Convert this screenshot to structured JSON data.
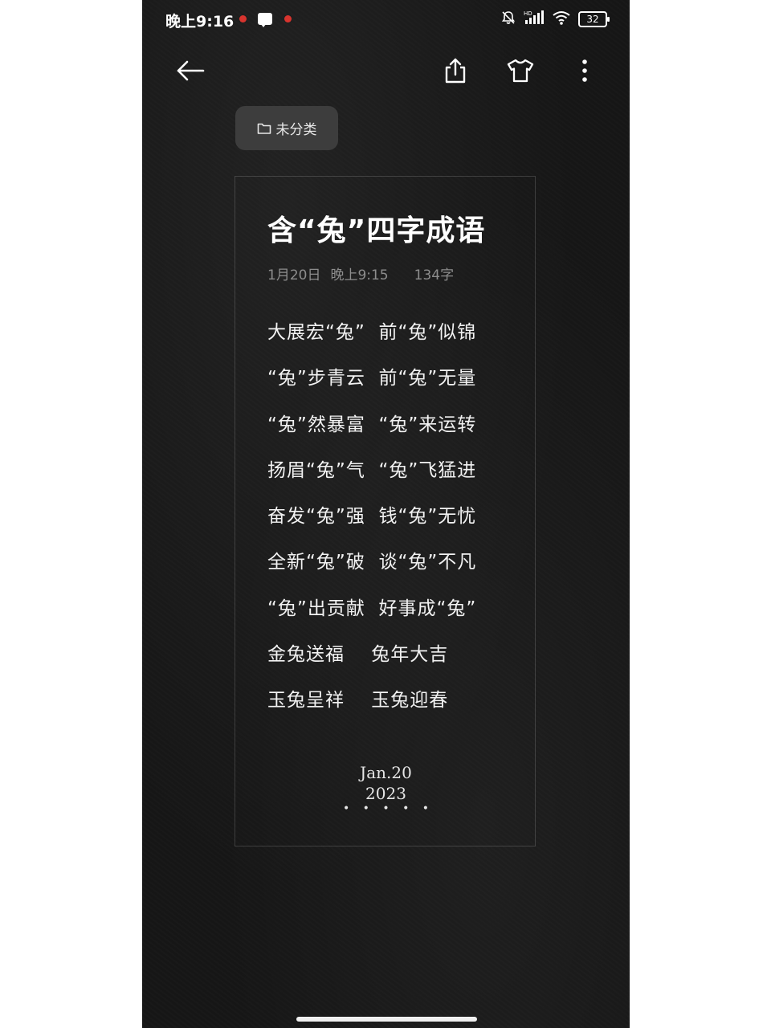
{
  "status_bar": {
    "time": "晚上9:16",
    "battery": "32",
    "icons": [
      "notification-dot-icon",
      "message-icon",
      "notification-dot-icon",
      "mute-icon",
      "hd-signal-icon",
      "wifi-icon",
      "battery-icon"
    ]
  },
  "toolbar": {
    "icons": [
      "back-arrow-icon",
      "share-icon",
      "theme-shirt-icon",
      "more-vertical-icon"
    ]
  },
  "folder_chip": {
    "label": "未分类",
    "icon": "folder-icon"
  },
  "note": {
    "title": "含“兔”四字成语",
    "date": "1月20日",
    "time": "晚上9:15",
    "word_count": "134字",
    "lines": [
      "大展宏“兔”  前“兔”似锦",
      "“兔”步青云  前“兔”无量",
      "“兔”然暴富  “兔”来运转",
      "扬眉“兔”气  “兔”飞猛进",
      "奋发“兔”强  钱“兔”无忧",
      "全新“兔”破  谈“兔”不凡",
      "“兔”出贡献  好事成“兔”",
      "金兔送福    兔年大吉",
      "玉兔呈祥    玉兔迎春"
    ],
    "footer_date_line1": "Jan.20",
    "footer_date_line2": "2023",
    "footer_dots": "• • • • •"
  },
  "colors": {
    "background": "#161616",
    "chip": "#3d3d3d",
    "meta_text": "#8d8d8d",
    "notification_dot": "#d8342e"
  }
}
